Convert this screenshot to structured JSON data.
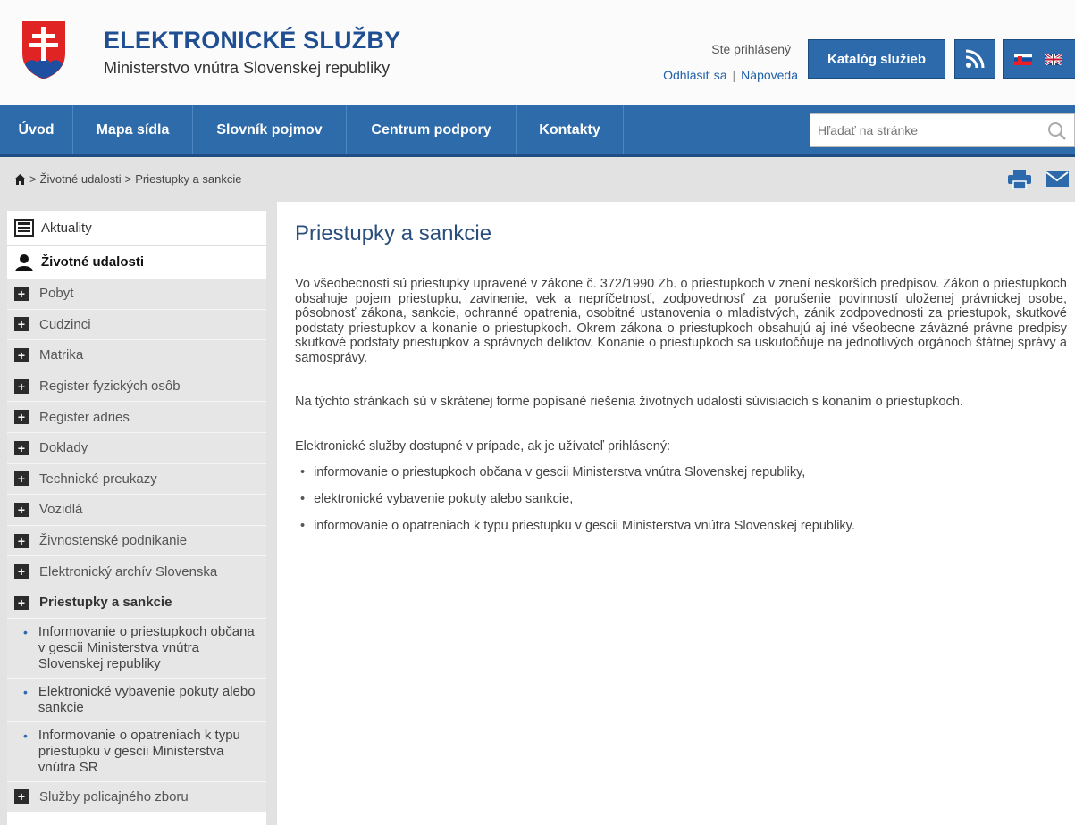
{
  "header": {
    "title": "ELEKTRONICKÉ SLUŽBY",
    "subtitle": "Ministerstvo vnútra Slovenskej republiky",
    "login_status": "Ste prihlásený",
    "logout": "Odhlásiť sa",
    "separator": "|",
    "help": "Nápoveda",
    "catalog_label": "Katalóg služieb"
  },
  "nav": {
    "items": [
      "Úvod",
      "Mapa sídla",
      "Slovník pojmov",
      "Centrum podpory",
      "Kontakty"
    ],
    "search_placeholder": "Hľadať na stránke"
  },
  "breadcrumb": {
    "items": [
      "Životné udalosti",
      "Priestupky a sankcie"
    ],
    "separator": ">"
  },
  "sidebar": {
    "news": "Aktuality",
    "life_events": "Životné udalosti",
    "items": [
      "Pobyt",
      "Cudzinci",
      "Matrika",
      "Register fyzických osôb",
      "Register adries",
      "Doklady",
      "Technické preukazy",
      "Vozidlá",
      "Živnostenské podnikanie",
      "Elektronický archív Slovenska",
      "Priestupky a sankcie"
    ],
    "sub_items": [
      "Informovanie o priestupkoch občana v gescii Ministerstva vnútra Slovenskej republiky",
      "Elektronické vybavenie pokuty alebo sankcie",
      "Informovanie o opatreniach k typu priestupku v gescii Ministerstva vnútra SR"
    ],
    "last_item": "Služby policajného zboru"
  },
  "main": {
    "title": "Priestupky a sankcie",
    "paragraph1": "Vo všeobecnosti sú priestupky upravené v zákone č. 372/1990 Zb. o priestupkoch v znení neskorších predpisov. Zákon o priestupkoch obsahuje pojem priestupku, zavinenie, vek a nepríčetnosť, zodpovednosť za porušenie povinností uloženej právnickej osobe, pôsobnosť zákona, sankcie, ochranné opatrenia, osobitné ustanovenia o mladistvých, zánik zodpovednosti za priestupok, skutkové podstaty priestupkov a konanie o priestupkoch. Okrem zákona o priestupkoch obsahujú aj iné všeobecne záväzné právne predpisy skutkové podstaty priestupkov a správnych deliktov. Konanie o priestupkoch sa uskutočňuje na jednotlivých orgánoch štátnej správy a samosprávy.",
    "paragraph2": "Na týchto stránkach sú v skrátenej forme popísané riešenia životných udalostí súvisiacich s konaním o priestupkoch.",
    "paragraph3": "Elektronické služby dostupné v prípade, ak je užívateľ prihlásený:",
    "bullet": "•",
    "bullets": [
      "informovanie o priestupkoch občana v gescii Ministerstva vnútra Slovenskej republiky,",
      "elektronické vybavenie pokuty alebo sankcie,",
      "informovanie o opatreniach k typu priestupku v gescii Ministerstva vnútra Slovenskej republiky."
    ]
  },
  "colors": {
    "brand_blue": "#1f4f92",
    "nav_blue": "#2e6bab",
    "heading_blue": "#2a4f7c",
    "gray_bg": "#e2e2e2"
  },
  "icons": [
    "coat-of-arms-logo",
    "rss-icon",
    "slovak-flag-icon",
    "english-flag-icon",
    "search-icon",
    "home-icon",
    "print-icon",
    "mail-icon",
    "news-icon",
    "person-icon",
    "plus-icon"
  ]
}
